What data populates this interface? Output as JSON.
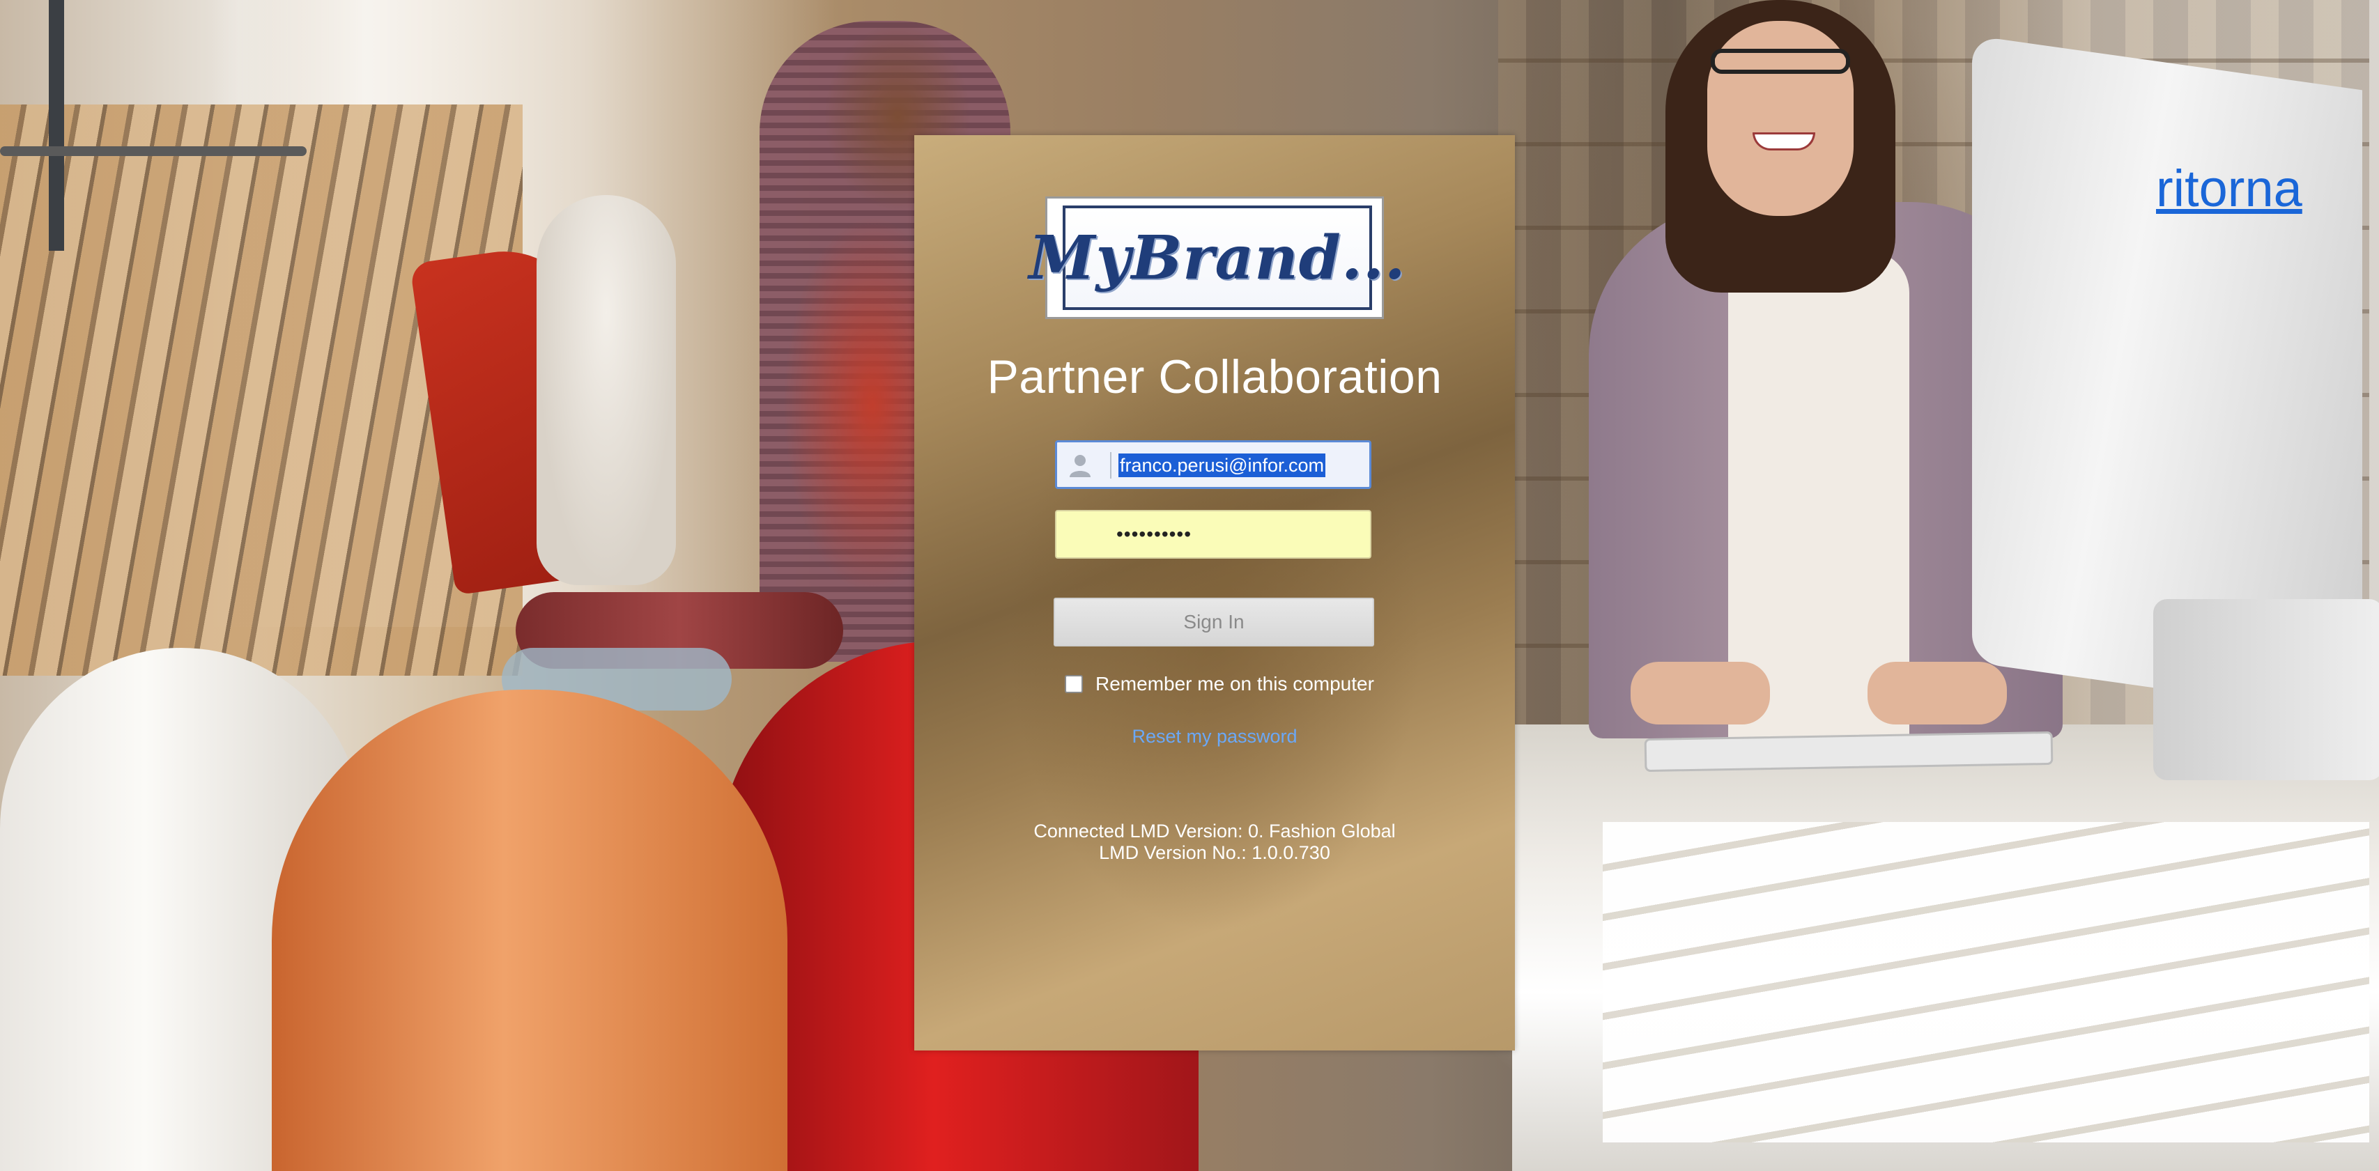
{
  "header": {
    "return_link": "ritorna"
  },
  "login": {
    "logo_text": "MyBrand...",
    "title": "Partner Collaboration",
    "username_value": "franco.perusi@infor.com",
    "password_value": "••••••••••",
    "sign_in_label": "Sign In",
    "remember_label": "Remember me on this computer",
    "remember_checked": false,
    "reset_label": "Reset my password",
    "version_line1": "Connected LMD Version: 0. Fashion Global",
    "version_line2": "LMD Version No.: 1.0.0.730"
  },
  "icons": {
    "user_field": "user-icon",
    "logo_mark": "radio-mark-icon"
  },
  "colors": {
    "link": "#1a66d8",
    "reset_link": "#6aa8f7",
    "selection": "#1c5fd6",
    "password_fill": "#fafcb8"
  }
}
